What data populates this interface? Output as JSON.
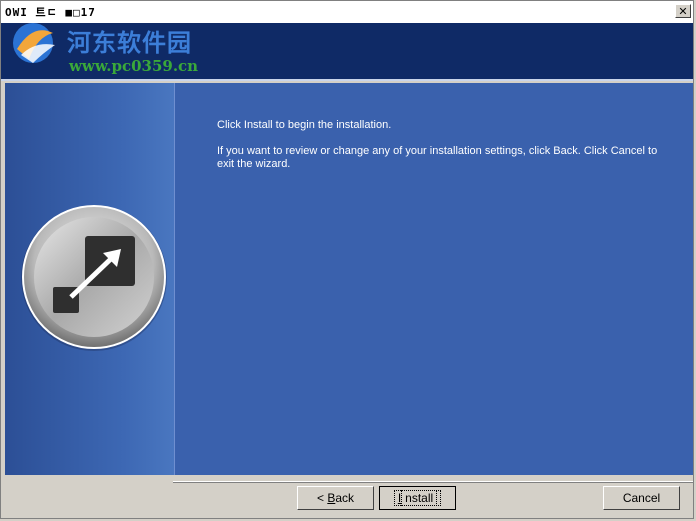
{
  "window": {
    "title": "OWI 트ㄷ ■□17",
    "close_glyph": "✕"
  },
  "watermark": {
    "site_name": "河东软件园",
    "url": "www.pc0359.cn"
  },
  "body": {
    "line1": "Click Install to begin the installation.",
    "line2": "If you want to review or change any of your installation settings, click Back. Click Cancel to exit the wizard."
  },
  "buttons": {
    "back_prefix": "< ",
    "back_key": "B",
    "back_rest": "ack",
    "install_key": "I",
    "install_rest": "nstall",
    "cancel": "Cancel"
  },
  "colors": {
    "header": "#0f2a66",
    "content": "#3a61ad",
    "sidebar": "#2c4f96",
    "watermark_title": "#3c7ed8",
    "watermark_url": "#3aa83a"
  },
  "icons": {
    "emblem": "metallic-install-emblem-icon",
    "watermark_logo": "pc0359-logo-icon"
  }
}
